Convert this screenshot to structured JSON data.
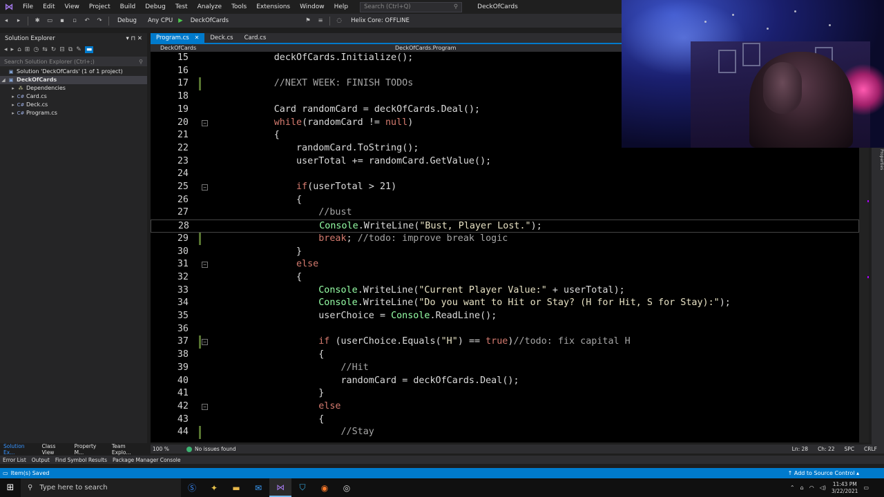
{
  "menubar": {
    "items": [
      "File",
      "Edit",
      "View",
      "Project",
      "Build",
      "Debug",
      "Test",
      "Analyze",
      "Tools",
      "Extensions",
      "Window",
      "Help"
    ],
    "search_placeholder": "Search (Ctrl+Q)",
    "app_title": "DeckOfCards"
  },
  "toolbar": {
    "config": "Debug",
    "platform": "Any CPU",
    "run_target": "DeckOfCards",
    "helix_status": "Helix Core: OFFLINE"
  },
  "solution_explorer": {
    "title": "Solution Explorer",
    "search_placeholder": "Search Solution Explorer (Ctrl+;)",
    "solution_label": "Solution 'DeckOfCards' (1 of 1 project)",
    "project_label": "DeckOfCards",
    "items": [
      "Dependencies",
      "Card.cs",
      "Deck.cs",
      "Program.cs"
    ],
    "bottom_tabs": [
      "Solution Ex...",
      "Class View",
      "Property M...",
      "Team Explo..."
    ]
  },
  "editor": {
    "tabs": [
      {
        "label": "Program.cs",
        "active": true
      },
      {
        "label": "Deck.cs",
        "active": false
      },
      {
        "label": "Card.cs",
        "active": false
      }
    ],
    "nav_left": "DeckOfCards",
    "nav_right": "DeckOfCards.Program",
    "lines": [
      {
        "n": "15",
        "text": "            deckOfCards.Initialize();"
      },
      {
        "n": "16",
        "text": ""
      },
      {
        "n": "17",
        "text": "            //NEXT WEEK: FINISH TODOs"
      },
      {
        "n": "18",
        "text": ""
      },
      {
        "n": "19",
        "text": "            Card randomCard = deckOfCards.Deal();"
      },
      {
        "n": "20",
        "text": "            while(randomCard != null)"
      },
      {
        "n": "21",
        "text": "            {"
      },
      {
        "n": "22",
        "text": "                randomCard.ToString();"
      },
      {
        "n": "23",
        "text": "                userTotal += randomCard.GetValue();"
      },
      {
        "n": "24",
        "text": ""
      },
      {
        "n": "25",
        "text": "                if(userTotal > 21)"
      },
      {
        "n": "26",
        "text": "                {"
      },
      {
        "n": "27",
        "text": "                    //bust"
      },
      {
        "n": "28",
        "text": "                    Console.WriteLine(\"Bust, Player Lost.\");"
      },
      {
        "n": "29",
        "text": "                    break; //todo: improve break logic"
      },
      {
        "n": "30",
        "text": "                }"
      },
      {
        "n": "31",
        "text": "                else"
      },
      {
        "n": "32",
        "text": "                {"
      },
      {
        "n": "33",
        "text": "                    Console.WriteLine(\"Current Player Value:\" + userTotal);"
      },
      {
        "n": "34",
        "text": "                    Console.WriteLine(\"Do you want to Hit or Stay? (H for Hit, S for Stay):\");"
      },
      {
        "n": "35",
        "text": "                    userChoice = Console.ReadLine();"
      },
      {
        "n": "36",
        "text": ""
      },
      {
        "n": "37",
        "text": "                    if (userChoice.Equals(\"H\") == true)//todo: fix capital H"
      },
      {
        "n": "38",
        "text": "                    {"
      },
      {
        "n": "39",
        "text": "                        //Hit"
      },
      {
        "n": "40",
        "text": "                        randomCard = deckOfCards.Deal();"
      },
      {
        "n": "41",
        "text": "                    }"
      },
      {
        "n": "42",
        "text": "                    else"
      },
      {
        "n": "43",
        "text": "                    {"
      },
      {
        "n": "44",
        "text": "                        //Stay"
      }
    ]
  },
  "editor_status": {
    "zoom": "100 %",
    "issues": "No issues found",
    "line": "Ln: 28",
    "col": "Ch: 22",
    "spc": "SPC",
    "eol": "CRLF"
  },
  "bottom_tabs": [
    "Error List",
    "Output",
    "Find Symbol Results",
    "Package Manager Console"
  ],
  "statusbar": {
    "message": "Item(s) Saved",
    "source_control": "Add to Source Control"
  },
  "taskbar": {
    "search_placeholder": "Type here to search",
    "time": "11:43 PM",
    "date": "3/22/2021"
  },
  "colors": {
    "accent": "#007acc",
    "keyword": "#d67b6f",
    "type": "#96ffa6",
    "comment": "#a6a6a6",
    "string": "#e9e3c5"
  }
}
